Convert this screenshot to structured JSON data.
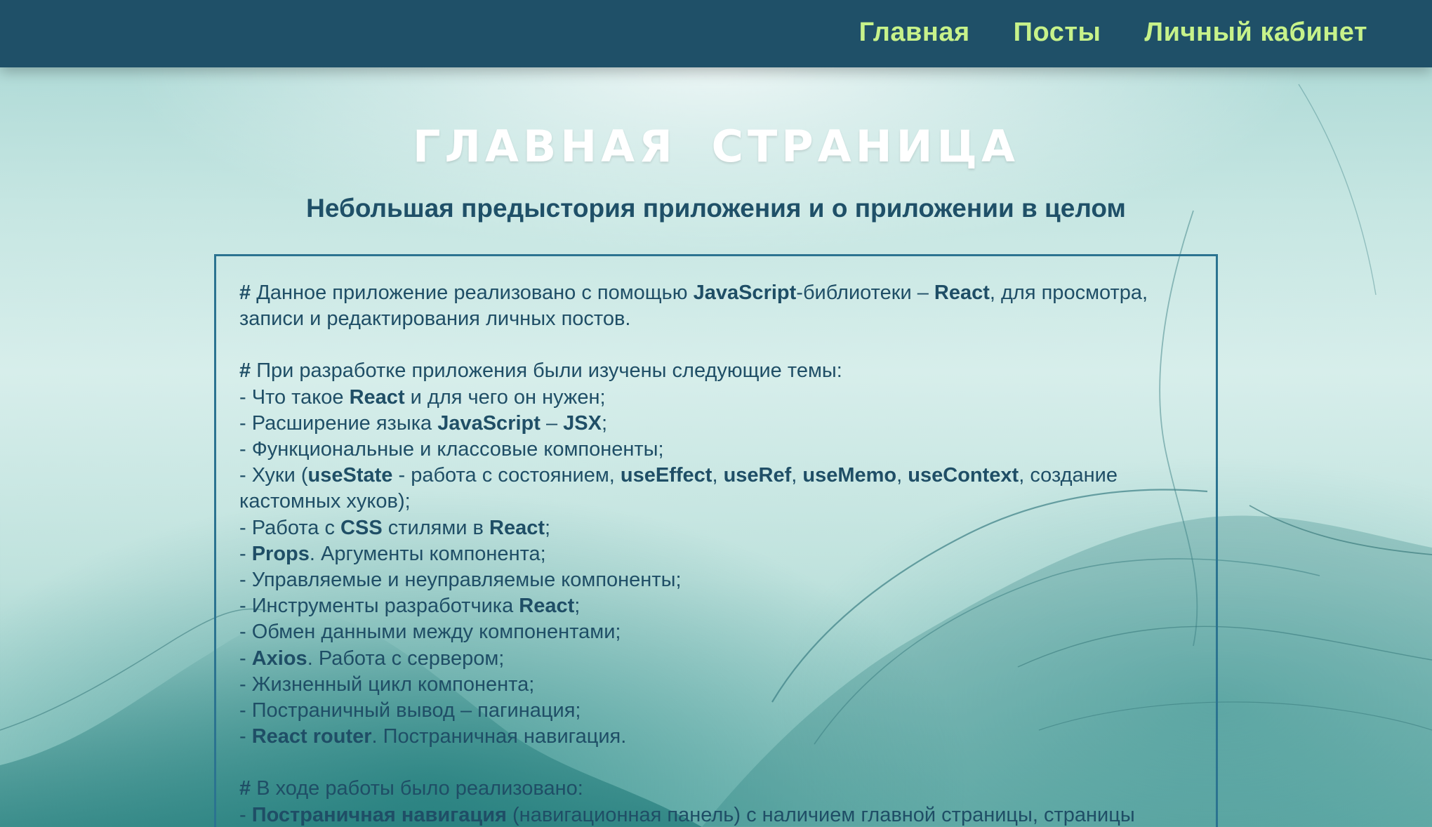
{
  "nav": {
    "links": [
      "Главная",
      "Посты",
      "Личный кабинет"
    ]
  },
  "page": {
    "title": "ГЛАВНАЯ  СТРАНИЦА",
    "subtitle": "Небольшая предыстория приложения и о приложении в целом"
  },
  "intro": {
    "hash": "#",
    "t1": " Данное приложение реализовано с помощью ",
    "kw1": "JavaScript",
    "t2": "-библиотеки – ",
    "kw2": "React",
    "t3": ", для просмотра, записи и редактирования личных постов."
  },
  "topics": {
    "hash": "#",
    "heading": " При разработке приложения были изучены следующие темы:",
    "i1": {
      "a": "- Что такое ",
      "b": "React",
      "c": " и для чего он нужен;"
    },
    "i2": {
      "a": "- Расширение языка ",
      "b": "JavaScript",
      "c": " – ",
      "d": "JSX",
      "e": ";"
    },
    "i3": {
      "a": "- Функциональные и классовые компоненты;"
    },
    "i4": {
      "a": "- Хуки (",
      "b": "useState",
      "c": " - работа с состоянием, ",
      "d": "useEffect",
      "e": ", ",
      "f": "useRef",
      "g": ", ",
      "h": "useMemo",
      "i": ", ",
      "j": "useContext",
      "k": ", создание кастомных хуков);"
    },
    "i5": {
      "a": "- Работа с ",
      "b": "CSS",
      "c": " стилями в ",
      "d": "React",
      "e": ";"
    },
    "i6": {
      "a": "- ",
      "b": "Props",
      "c": ". Аргументы компонента;"
    },
    "i7": {
      "a": "- Управляемые и неуправляемые компоненты;"
    },
    "i8": {
      "a": "- Инструменты разработчика ",
      "b": "React",
      "c": ";"
    },
    "i9": {
      "a": "- Обмен данными между компонентами;"
    },
    "i10": {
      "a": "- ",
      "b": "Axios",
      "c": ". Работа с сервером;"
    },
    "i11": {
      "a": "- Жизненный цикл компонента;"
    },
    "i12": {
      "a": "- Постраничный вывод – пагинация;"
    },
    "i13": {
      "a": "- ",
      "b": "React router",
      "c": ". Постраничная навигация."
    }
  },
  "done": {
    "hash": "#",
    "heading": " В ходе работы было реализовано:",
    "i1": {
      "a": "- ",
      "b": "Постраничная навигация",
      "c": " (навигационная панель) с наличием главной страницы, страницы"
    }
  },
  "colors": {
    "navbar": "#1f5068",
    "nav_link": "#c7f28a",
    "text": "#1f4e66",
    "border": "#2b7390"
  }
}
